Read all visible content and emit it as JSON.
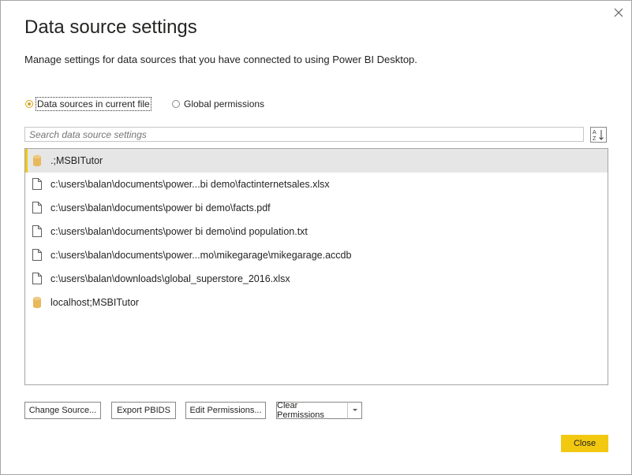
{
  "dialog": {
    "title": "Data source settings",
    "description": "Manage settings for data sources that you have connected to using Power BI Desktop.",
    "close_icon": "close-icon"
  },
  "scope": {
    "options": [
      {
        "label": "Data sources in current file",
        "selected": true
      },
      {
        "label": "Global permissions",
        "selected": false
      }
    ]
  },
  "search": {
    "placeholder": "Search data source settings",
    "sort_icon": "sort-az-icon"
  },
  "sources": [
    {
      "label": ".;MSBITutor",
      "icon": "database-icon",
      "selected": true
    },
    {
      "label": "c:\\users\\balan\\documents\\power...bi demo\\factinternetsales.xlsx",
      "icon": "file-icon",
      "selected": false
    },
    {
      "label": "c:\\users\\balan\\documents\\power bi demo\\facts.pdf",
      "icon": "file-icon",
      "selected": false
    },
    {
      "label": "c:\\users\\balan\\documents\\power bi demo\\ind population.txt",
      "icon": "file-icon",
      "selected": false
    },
    {
      "label": "c:\\users\\balan\\documents\\power...mo\\mikegarage\\mikegarage.accdb",
      "icon": "file-icon",
      "selected": false
    },
    {
      "label": "c:\\users\\balan\\downloads\\global_superstore_2016.xlsx",
      "icon": "file-icon",
      "selected": false
    },
    {
      "label": "localhost;MSBITutor",
      "icon": "database-icon",
      "selected": false
    }
  ],
  "actions": {
    "change_source": "Change Source...",
    "export_pbids": "Export PBIDS",
    "edit_permissions": "Edit Permissions...",
    "clear_permissions": "Clear Permissions"
  },
  "footer": {
    "close_label": "Close"
  },
  "colors": {
    "accent": "#f2c811",
    "radio_accent": "#d8a41b",
    "database_icon": "#e8b85c",
    "selected_row": "#e6e6e6"
  }
}
